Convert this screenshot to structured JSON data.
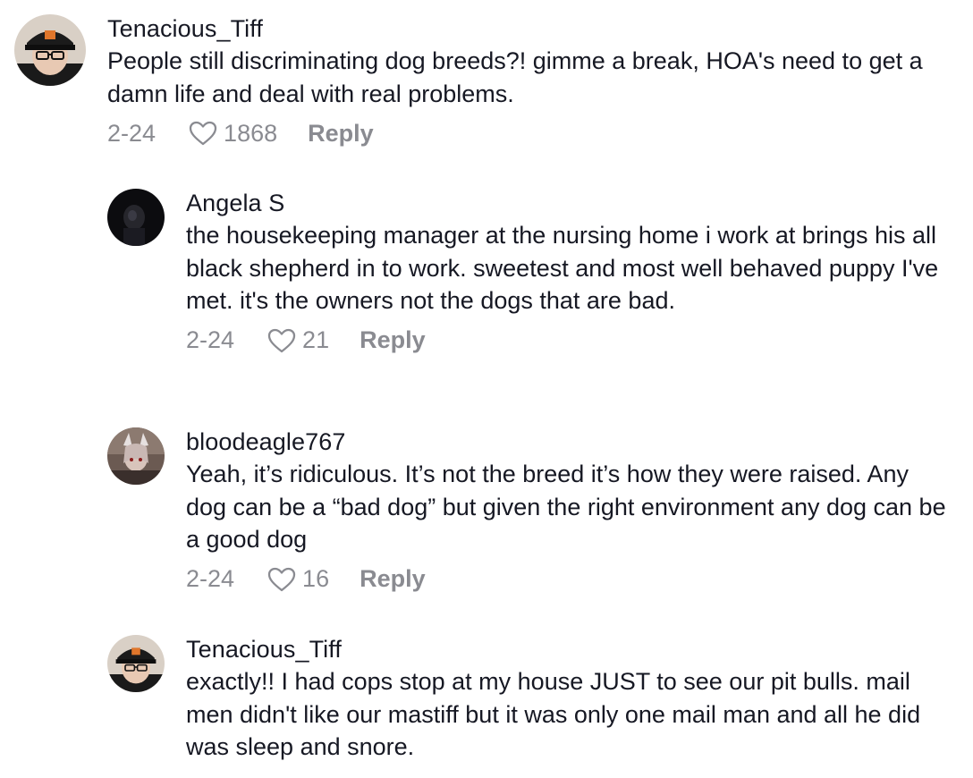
{
  "comments": [
    {
      "username": "Tenacious_Tiff",
      "text": "People still discriminating dog breeds?! gimme a break, HOA's need to get a damn life and deal with real problems.",
      "date": "2-24",
      "likes": "1868",
      "reply_label": "Reply",
      "avatar_icon": "user-avatar-cap-glasses"
    },
    {
      "username": "Angela S",
      "text": "the housekeeping manager at the nursing home i work at brings his all black shepherd in to work. sweetest and most well behaved puppy I've met. it's the owners not the dogs that are bad.",
      "date": "2-24",
      "likes": "21",
      "reply_label": "Reply",
      "avatar_icon": "user-avatar-dark"
    },
    {
      "username": "bloodeagle767",
      "text": "Yeah, it’s ridiculous. It’s not the breed it’s how they were raised. Any dog can be a “bad dog” but given the right environment any dog can be a good dog",
      "date": "2-24",
      "likes": "16",
      "reply_label": "Reply",
      "avatar_icon": "user-avatar-art"
    },
    {
      "username": "Tenacious_Tiff",
      "text": "exactly!! I had cops stop at my house JUST to see our pit bulls. mail men didn't like our mastiff but it was only one mail man and all he did was sleep and snore.",
      "date": "",
      "likes": "",
      "reply_label": "",
      "avatar_icon": "user-avatar-cap-glasses"
    }
  ],
  "colors": {
    "text": "#161823",
    "meta": "#8a8b91",
    "background": "#ffffff"
  }
}
